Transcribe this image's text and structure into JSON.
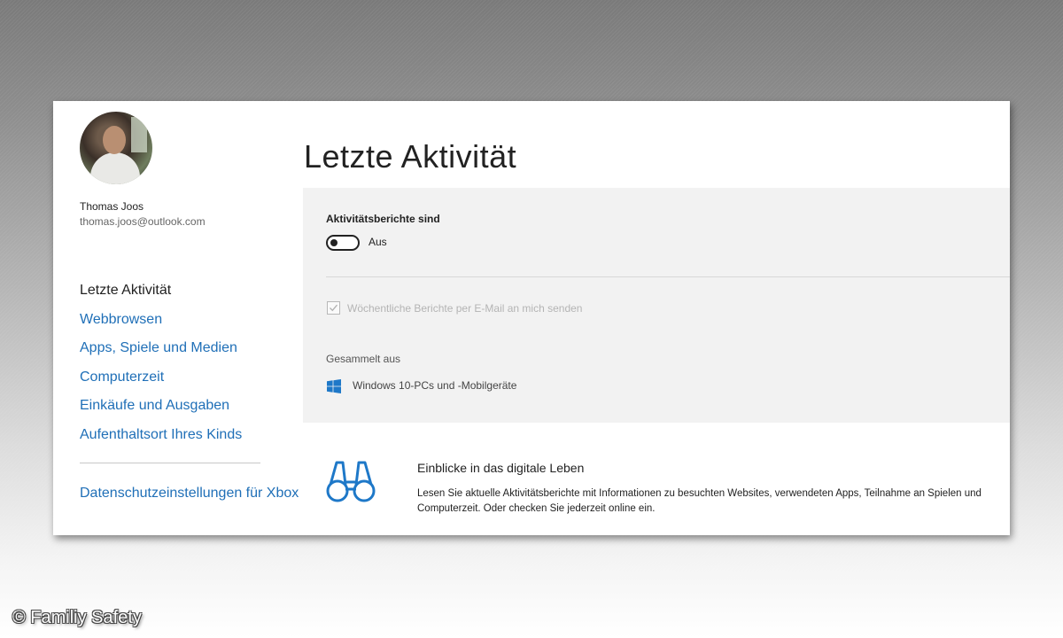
{
  "user": {
    "name": "Thomas Joos",
    "email": "thomas.joos@outlook.com"
  },
  "sidebar": {
    "items": [
      {
        "label": "Letzte Aktivität",
        "active": true
      },
      {
        "label": "Webbrowsen",
        "active": false
      },
      {
        "label": "Apps, Spiele und Medien",
        "active": false
      },
      {
        "label": "Computerzeit",
        "active": false
      },
      {
        "label": "Einkäufe und Ausgaben",
        "active": false
      },
      {
        "label": "Aufenthaltsort Ihres Kinds",
        "active": false
      }
    ],
    "xbox_link": "Datenschutzeinstellungen für Xbox"
  },
  "main": {
    "title": "Letzte Aktivität",
    "activity_reports": {
      "label": "Aktivitätsberichte sind",
      "toggle_on": false,
      "state_text": "Aus"
    },
    "weekly_email": {
      "label": "Wöchentliche Berichte per E-Mail an mich senden",
      "checked": true,
      "disabled": true
    },
    "collected_from": {
      "label": "Gesammelt aus",
      "source": "Windows 10-PCs und -Mobilgeräte",
      "icon": "windows-logo-icon"
    },
    "info": {
      "icon": "binoculars-icon",
      "title": "Einblicke in das digitale Leben",
      "text": "Lesen Sie aktuelle Aktivitätsberichte mit Informationen zu besuchten Websites, verwendeten Apps, Teilnahme an Spielen und Computerzeit. Oder checken Sie jederzeit online ein."
    }
  },
  "watermark": "© Familiy Safety",
  "colors": {
    "link": "#1f6fb7",
    "accent_icon": "#1e78c8",
    "panel_bg": "#f2f2f2"
  }
}
